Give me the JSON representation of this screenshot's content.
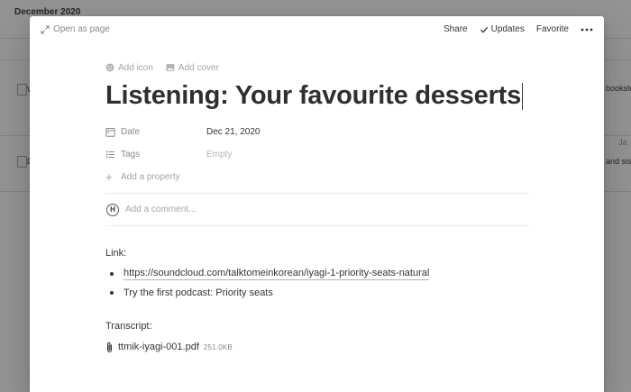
{
  "background": {
    "title": "December 2020",
    "left_row1": "W",
    "left_row2": "D",
    "right_row1": "bookstore",
    "right_row2": "and siste",
    "right_cell_top": "Ja"
  },
  "topbar": {
    "open_as_page": "Open as page",
    "share": "Share",
    "updates": "Updates",
    "favorite": "Favorite"
  },
  "page": {
    "add_icon": "Add icon",
    "add_cover": "Add cover",
    "title": "Listening: Your favourite desserts",
    "properties": [
      {
        "icon": "calendar-icon",
        "name": "Date",
        "value": "Dec 21, 2020"
      },
      {
        "icon": "list-icon",
        "name": "Tags",
        "value": "Empty"
      }
    ],
    "add_property": "Add a property",
    "comment_avatar": "H",
    "comment_placeholder": "Add a comment..."
  },
  "body": {
    "link_label": "Link:",
    "bullets": [
      "https://soundcloud.com/talktomeinkorean/iyagi-1-priority-seats-natural",
      "Try the  first podcast: Priority seats"
    ],
    "transcript_label": "Transcript:",
    "file_name": "ttmik-iyagi-001.pdf",
    "file_size": "251.0KB"
  }
}
